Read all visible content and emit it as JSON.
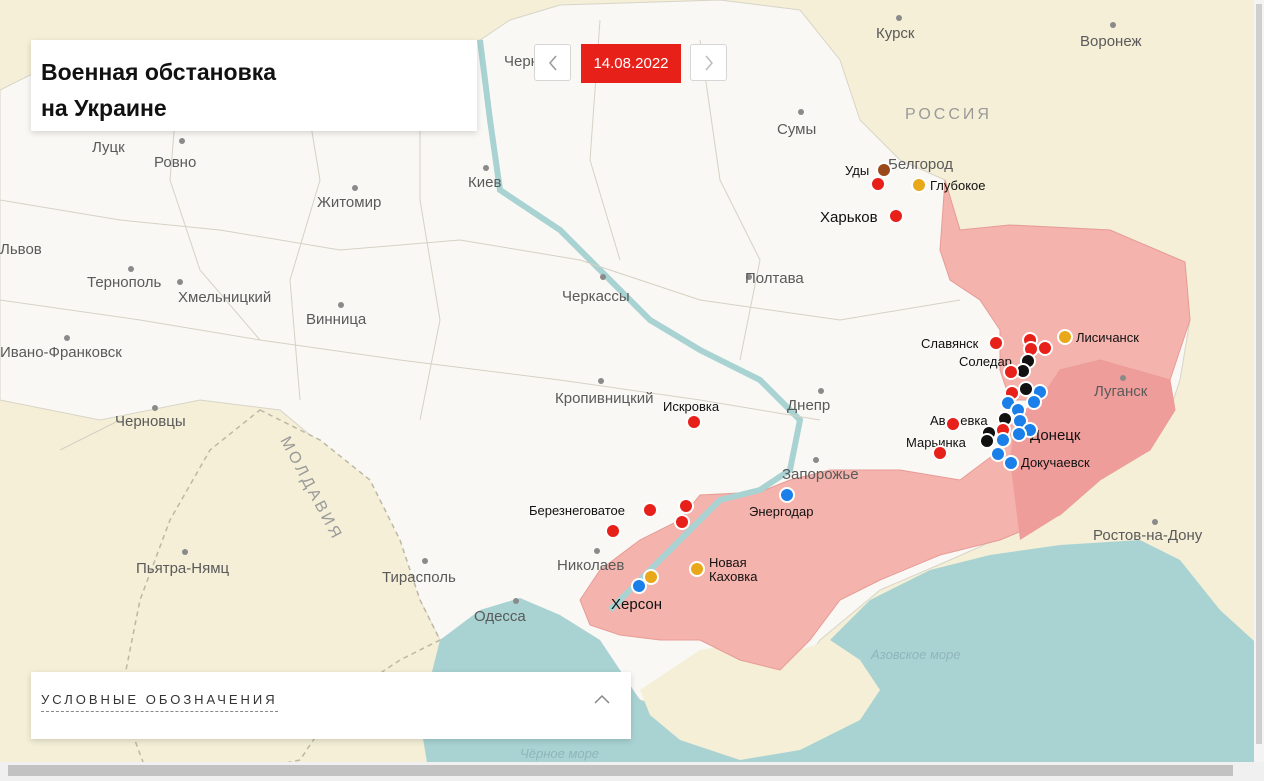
{
  "title": "Военная обстановка на Украине",
  "date": "14.08.2022",
  "legend_title": "УСЛОВНЫЕ ОБОЗНАЧЕНИЯ",
  "colors": {
    "occupied_area": "#f5b3ad",
    "occupied_area_dark": "#ef9d9b",
    "sea": "#a9d3d3",
    "land": "#f8f7f3",
    "neighbor_land": "#f4efd6",
    "red_marker": "#e8201a",
    "blue_marker": "#1a7fe8",
    "black_marker": "#111111",
    "orange_marker": "#e8a81a",
    "brown_marker": "#9a4a1a"
  },
  "labels": {
    "country_russia": "РОССИЯ",
    "country_moldova": "МОЛДАВИЯ",
    "sea_azov": "Азовское море",
    "sea_black": "Чёрное море",
    "kursk": "Курск",
    "voronezh": "Воронеж",
    "chernigov": "Чернигов",
    "sumy": "Сумы",
    "belgorod": "Белгород",
    "udy": "Уды",
    "glubokoe": "Глубокое",
    "kharkov": "Харьков",
    "kiev": "Киев",
    "lutsk": "Луцк",
    "rovno": "Ровно",
    "zhitomir": "Житомир",
    "lvov": "Львов",
    "ternopol": "Тернополь",
    "khmelnitsky": "Хмельницкий",
    "vinnitsa": "Винница",
    "ivano_frankovsk": "Ивано-Франковск",
    "chernovtsy": "Черновцы",
    "cherkassy": "Черкассы",
    "poltava": "Полтава",
    "kropivnitsky": "Кропивницкий",
    "iskrovka": "Искровка",
    "dnepr": "Днепр",
    "zaporozhye": "Запорожье",
    "energodar": "Энергодар",
    "bereznegovatoe": "Березнеговатое",
    "nikolaev": "Николаев",
    "kherson": "Херсон",
    "novaya_kakhovka_1": "Новая",
    "novaya_kakhovka_2": "Каховка",
    "odessa": "Одесса",
    "tiraspol": "Тирасполь",
    "pyatra_namts": "Пьятра-Нямц",
    "slavyansk": "Славянск",
    "soledar": "Соледар",
    "lisichansk": "Лисичанск",
    "lugansk": "Луганск",
    "avdeevka": "Авдеевка",
    "marinka": "Марьинка",
    "donetsk": "Донецк",
    "dokuchaevsk": "Докучаевск",
    "rostov": "Ростов-на-Дону"
  }
}
